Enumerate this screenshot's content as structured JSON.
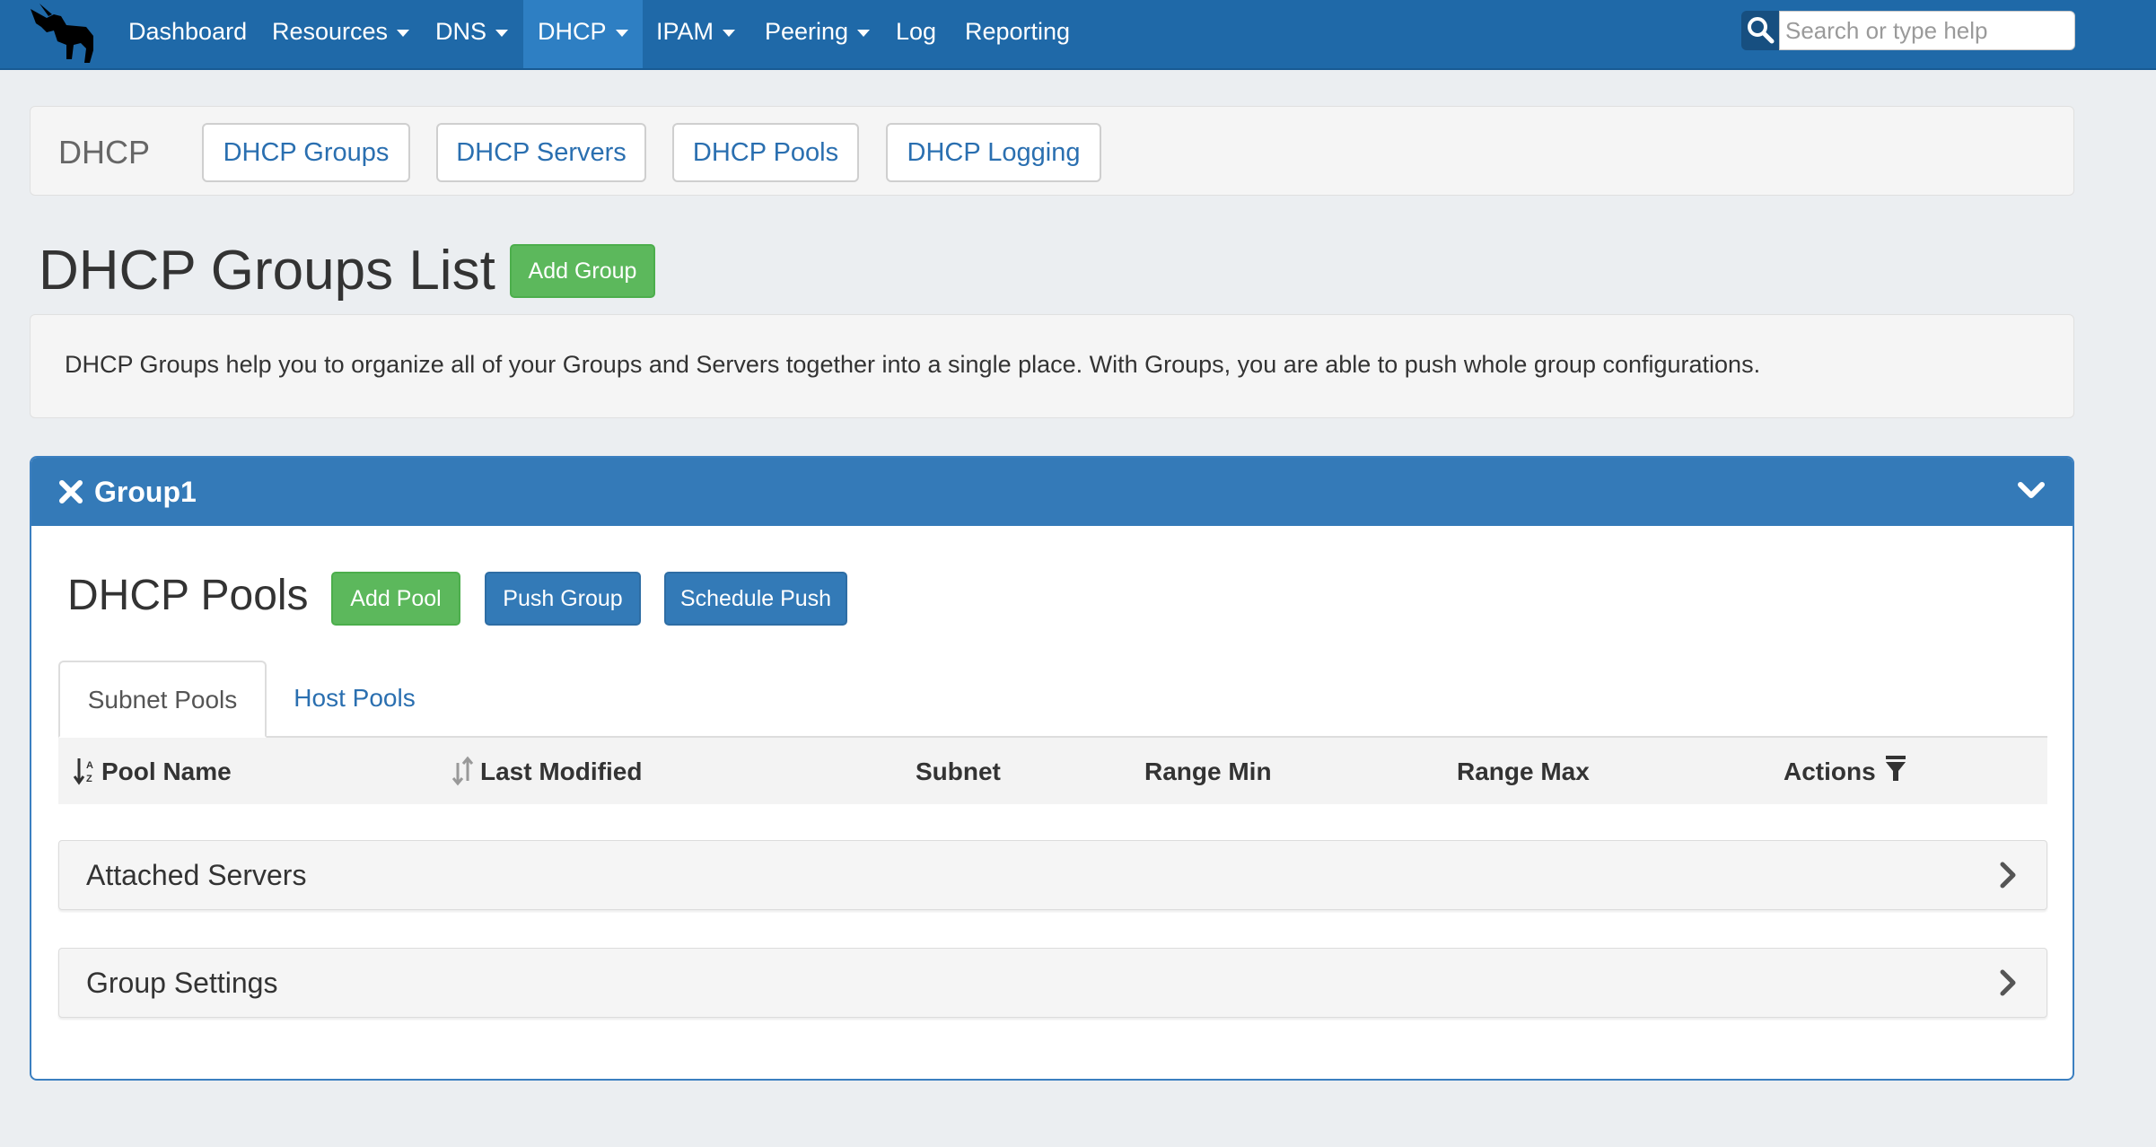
{
  "nav": {
    "items": [
      {
        "label": "Dashboard",
        "dropdown": false
      },
      {
        "label": "Resources",
        "dropdown": true
      },
      {
        "label": "DNS",
        "dropdown": true
      },
      {
        "label": "DHCP",
        "dropdown": true,
        "active": true
      },
      {
        "label": "IPAM",
        "dropdown": true
      },
      {
        "label": "Peering",
        "dropdown": true
      },
      {
        "label": "Log",
        "dropdown": false
      },
      {
        "label": "Reporting",
        "dropdown": false
      }
    ],
    "search_placeholder": "Search or type help",
    "logo_icon": "unicorn-logo-icon",
    "colors": {
      "navbar": "#1f69a8",
      "active": "#2e7fc3"
    }
  },
  "subnav": {
    "title": "DHCP",
    "buttons": [
      "DHCP Groups",
      "DHCP Servers",
      "DHCP Pools",
      "DHCP Logging"
    ]
  },
  "page": {
    "title": "DHCP Groups List",
    "add_group_label": "Add Group",
    "description": "DHCP Groups help you to organize all of your Groups and Servers together into a single place. With Groups, you are able to push whole group configurations."
  },
  "group_panel": {
    "name": "Group1",
    "pools_title": "DHCP Pools",
    "add_pool_label": "Add Pool",
    "push_group_label": "Push Group",
    "schedule_push_label": "Schedule Push",
    "tabs": [
      "Subnet Pools",
      "Host Pools"
    ],
    "table_headers": [
      "Pool Name",
      "Last Modified",
      "Subnet",
      "Range Min",
      "Range Max",
      "Actions"
    ],
    "sections": [
      "Attached Servers",
      "Group Settings"
    ]
  },
  "colors": {
    "primary": "#337ab7",
    "success": "#5cb85c",
    "link": "#2a6fb0",
    "page_bg": "#ebeef1"
  }
}
